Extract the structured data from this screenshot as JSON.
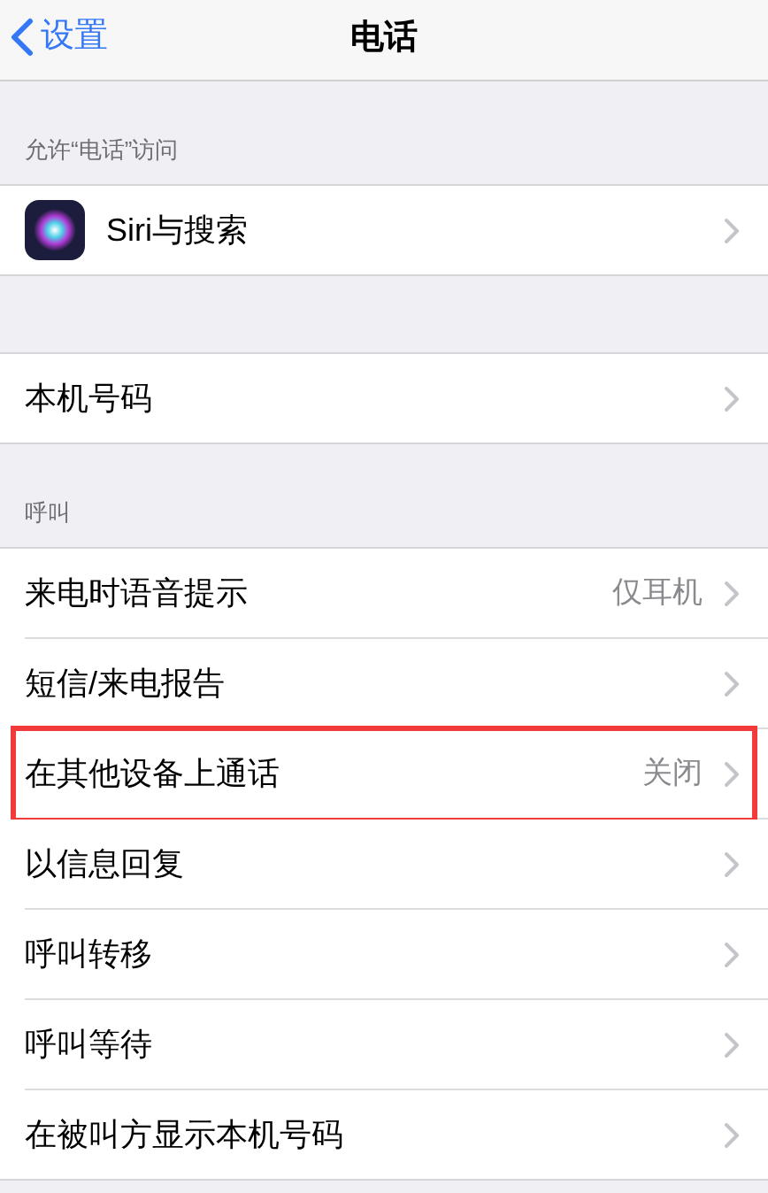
{
  "nav": {
    "back": "设置",
    "title": "电话"
  },
  "sections": [
    {
      "header": "允许“电话”访问",
      "rows": [
        {
          "label": "Siri与搜索",
          "kind": "app",
          "highlighted": false
        }
      ]
    },
    {
      "rows": [
        {
          "label": "本机号码",
          "highlighted": false
        }
      ]
    },
    {
      "header": "呼叫",
      "rows": [
        {
          "label": "来电时语音提示",
          "value": "仅耳机",
          "highlighted": false
        },
        {
          "label": "短信/来电报告",
          "highlighted": false
        },
        {
          "label": "在其他设备上通话",
          "value": "关闭",
          "highlighted": true
        },
        {
          "label": "以信息回复",
          "highlighted": false
        },
        {
          "label": "呼叫转移",
          "highlighted": false
        },
        {
          "label": "呼叫等待",
          "highlighted": false
        },
        {
          "label": "在被叫方显示本机号码",
          "highlighted": false
        }
      ]
    }
  ]
}
